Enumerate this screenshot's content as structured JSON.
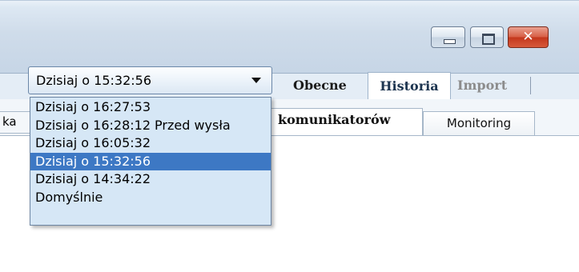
{
  "window": {
    "minimize_icon": "minimize-icon",
    "maximize_icon": "maximize-icon",
    "close_icon": "close-icon",
    "close_glyph": "✕"
  },
  "combo": {
    "value": "Dzisiaj o 15:32:56",
    "arrow_icon": "chevron-down-icon"
  },
  "top_tabs": {
    "obecne": "Obecne",
    "historia": "Historia",
    "import": "Import"
  },
  "sub_tabs": {
    "left_partial": "ka",
    "komunikatorow": "komunikatorów",
    "monitoring": "Monitoring"
  },
  "dropdown": {
    "items": [
      {
        "label": "Dzisiaj o 16:27:53",
        "note": ""
      },
      {
        "label": "Dzisiaj o 16:28:12",
        "note": "Przed wysła"
      },
      {
        "label": "Dzisiaj o 16:05:32",
        "note": ""
      },
      {
        "label": "Dzisiaj o 15:32:56",
        "note": ""
      },
      {
        "label": "Dzisiaj o 14:34:22",
        "note": ""
      },
      {
        "label": "Domyślnie",
        "note": ""
      }
    ],
    "selected_index": 3
  },
  "colors": {
    "selection": "#3d78c4",
    "dropdown_bg": "#d6e7f6",
    "close_button": "#c3371c"
  }
}
